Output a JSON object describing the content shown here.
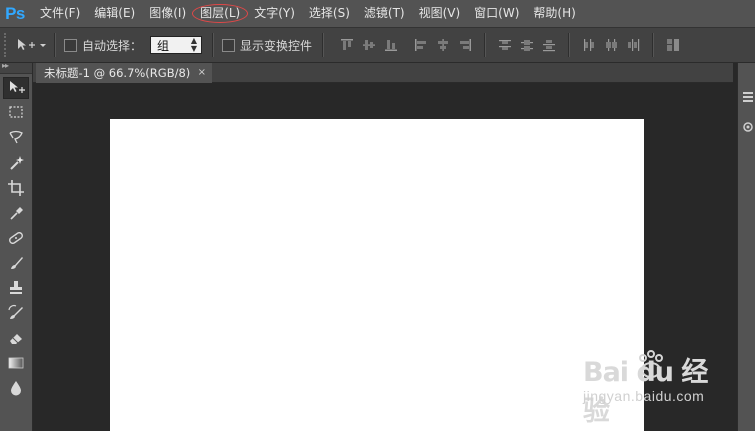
{
  "app": {
    "logo": "Ps"
  },
  "menu": [
    {
      "label": "文件(F)",
      "circled": false
    },
    {
      "label": "编辑(E)",
      "circled": false
    },
    {
      "label": "图像(I)",
      "circled": false
    },
    {
      "label": "图层(L)",
      "circled": true
    },
    {
      "label": "文字(Y)",
      "circled": false
    },
    {
      "label": "选择(S)",
      "circled": false
    },
    {
      "label": "滤镜(T)",
      "circled": false
    },
    {
      "label": "视图(V)",
      "circled": false
    },
    {
      "label": "窗口(W)",
      "circled": false
    },
    {
      "label": "帮助(H)",
      "circled": false
    }
  ],
  "options": {
    "auto_select_label": "自动选择：",
    "auto_select_checked": false,
    "auto_select_value": "组",
    "show_transform_label": "显示变换控件",
    "show_transform_checked": false
  },
  "tools": [
    {
      "icon": "move-tool-icon",
      "active": true
    },
    {
      "icon": "marquee-tool-icon",
      "active": false
    },
    {
      "icon": "lasso-tool-icon",
      "active": false
    },
    {
      "icon": "magic-wand-tool-icon",
      "active": false
    },
    {
      "icon": "crop-tool-icon",
      "active": false
    },
    {
      "icon": "eyedropper-tool-icon",
      "active": false
    },
    {
      "icon": "healing-brush-tool-icon",
      "active": false
    },
    {
      "icon": "brush-tool-icon",
      "active": false
    },
    {
      "icon": "clone-stamp-tool-icon",
      "active": false
    },
    {
      "icon": "history-brush-tool-icon",
      "active": false
    },
    {
      "icon": "eraser-tool-icon",
      "active": false
    },
    {
      "icon": "gradient-tool-icon",
      "active": false
    },
    {
      "icon": "blur-tool-icon",
      "active": false
    }
  ],
  "document": {
    "tab_title": "未标题-1 @ 66.7%(RGB/8)",
    "close_symbol": "×",
    "canvas_color": "#ffffff"
  },
  "colors": {
    "menubar": "#535353",
    "workspace": "#282828",
    "ps_blue": "#31a8ff",
    "highlight_circle": "#e04848"
  },
  "watermark": {
    "main": "Bai du 经验",
    "sub": "jingyan.baidu.com"
  }
}
